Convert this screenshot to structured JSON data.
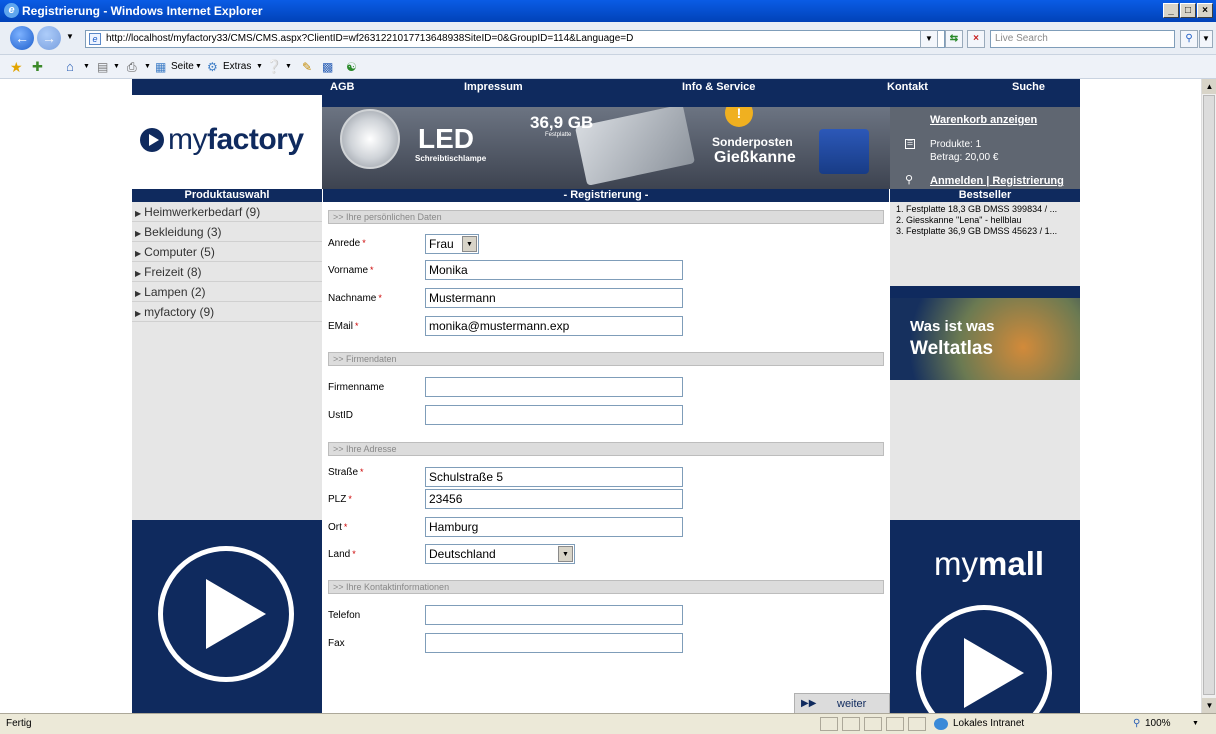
{
  "window": {
    "title": "Registrierung - Windows Internet Explorer"
  },
  "addressbar": {
    "url": "http://localhost/myfactory33/CMS/CMS.aspx?ClientID=wf2631221017713648938SiteID=0&GroupID=114&Language=D",
    "search_placeholder": "Live Search"
  },
  "commandbar": {
    "page_label": "Seite",
    "extras_label": "Extras"
  },
  "topnav": [
    "AGB",
    "Impressum",
    "Info & Service",
    "Kontakt",
    "Suche"
  ],
  "logo": {
    "light": "my",
    "bold": "factory"
  },
  "banner": {
    "led": "LED",
    "led_sub": "Schreibtischlampe",
    "hdd_size": "36,9 GB",
    "hdd_sub": "Festplatte",
    "sale_line1": "Sonderposten",
    "sale_line2": "Gießkanne"
  },
  "cart": {
    "show_cart": "Warenkorb anzeigen",
    "products": "Produkte: 1",
    "amount": "Betrag: 20,00 €",
    "login": "Anmelden | Registrierung"
  },
  "left": {
    "header": "Produktauswahl",
    "categories": [
      "Heimwerkerbedarf (9)",
      "Bekleidung (3)",
      "Computer (5)",
      "Freizeit (8)",
      "Lampen (2)",
      "myfactory (9)"
    ]
  },
  "main": {
    "header": "- Registrierung -",
    "sections": {
      "personal": ">> Ihre persönlichen Daten",
      "company": ">> Firmendaten",
      "address": ">> Ihre Adresse",
      "contact": ">> Ihre Kontaktinformationen"
    },
    "labels": {
      "anrede": "Anrede",
      "vorname": "Vorname",
      "nachname": "Nachname",
      "email": "EMail",
      "firmenname": "Firmenname",
      "ustid": "UstID",
      "strasse": "Straße",
      "plz": "PLZ",
      "ort": "Ort",
      "land": "Land",
      "telefon": "Telefon",
      "fax": "Fax"
    },
    "values": {
      "anrede": "Frau",
      "vorname": "Monika",
      "nachname": "Mustermann",
      "email": "monika@mustermann.exp",
      "firmenname": "",
      "ustid": "",
      "strasse": "Schulstraße 5",
      "plz": "23456",
      "ort": "Hamburg",
      "land": "Deutschland",
      "telefon": "",
      "fax": ""
    },
    "required_marker": "*",
    "submit": "weiter"
  },
  "right": {
    "header": "Bestseller",
    "bestsellers": [
      "1. Festplatte 18,3 GB DMSS 399834 / ...",
      "2. Giesskanne \"Lena\" - hellblau",
      "3. Festplatte 36,9 GB DMSS 45623 / 1..."
    ],
    "atlas_line1": "Was ist was",
    "atlas_line2": "Weltatlas",
    "mymall_light": "my",
    "mymall_bold": "mall"
  },
  "statusbar": {
    "status": "Fertig",
    "zone": "Lokales Intranet",
    "zoom": "100%"
  }
}
